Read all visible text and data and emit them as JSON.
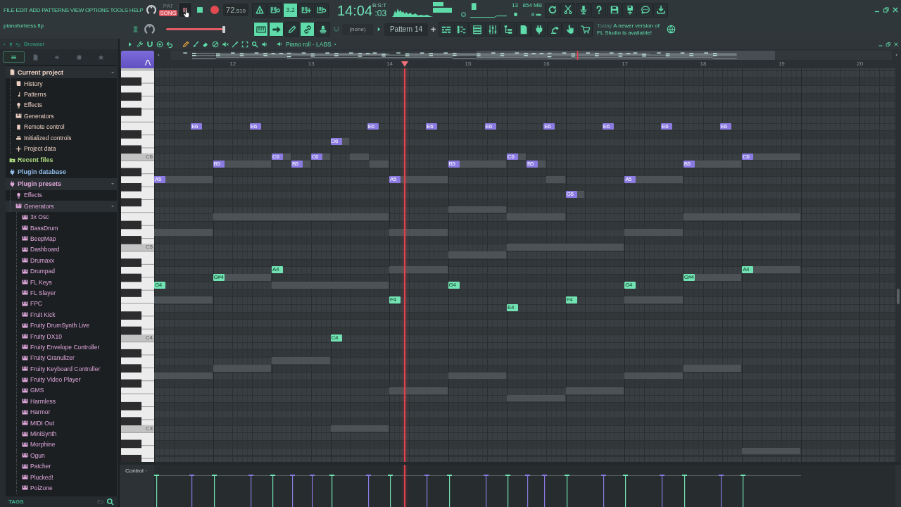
{
  "menu": [
    "FILE",
    "EDIT",
    "ADD",
    "PATTERNS",
    "VIEW",
    "OPTIONS",
    "TOOLS",
    "HELP"
  ],
  "project_file": "pianofortress.flp",
  "transport": {
    "pat_label": "PAT",
    "song_label": "SONG",
    "song_mode": true,
    "playing": true,
    "tempo": "72",
    "tempo_decimals": ".510"
  },
  "record_options": [
    {
      "on": false
    },
    {
      "on": false
    },
    {
      "label": "3.2",
      "on": true
    },
    {
      "on": false
    },
    {
      "on": false
    }
  ],
  "clock": {
    "time": "14:04",
    "seconds": ":03",
    "format": "B:S:T"
  },
  "monitor": {
    "voices": "13",
    "memory": "854 MB",
    "polyphony": "8"
  },
  "song_position": {
    "level": 0.98
  },
  "tool_buttons": [
    {
      "on": true
    },
    {
      "on": true
    },
    {
      "on": false
    },
    {
      "on": true
    },
    {
      "on": false
    }
  ],
  "pattern": {
    "channel": "(none)",
    "name": "Pattern 14"
  },
  "news": {
    "date": "Today",
    "message": "A newer version of FL Studio is available!"
  },
  "browser": {
    "title": "Browser",
    "tabs": [
      {
        "selected": true
      },
      {
        "selected": false
      },
      {
        "selected": false
      },
      {
        "selected": false
      },
      {
        "selected": false
      }
    ],
    "tree": [
      {
        "label": "Current project",
        "color": "#ecd0c2",
        "expanded": true,
        "children": [
          {
            "label": "History"
          },
          {
            "label": "Patterns"
          },
          {
            "label": "Effects"
          },
          {
            "label": "Generators"
          },
          {
            "label": "Remote control"
          },
          {
            "label": "Initialized controls"
          },
          {
            "label": "Project data"
          }
        ]
      },
      {
        "label": "Recent files",
        "color": "#a9d77c",
        "expanded": false
      },
      {
        "label": "Plugin database",
        "color": "#8fbbe8",
        "expanded": false
      },
      {
        "label": "Plugin presets",
        "color": "#dfa6da",
        "expanded": true,
        "children": [
          {
            "label": "Effects",
            "expanded": false
          },
          {
            "label": "Generators",
            "expanded": true,
            "children": [
              {
                "label": "3x Osc"
              },
              {
                "label": "BassDrum"
              },
              {
                "label": "BeepMap"
              },
              {
                "label": "Dashboard"
              },
              {
                "label": "Drumaxx"
              },
              {
                "label": "Drumpad"
              },
              {
                "label": "FL Keys"
              },
              {
                "label": "FL Slayer"
              },
              {
                "label": "FPC"
              },
              {
                "label": "Fruit Kick"
              },
              {
                "label": "Fruity DrumSynth Live"
              },
              {
                "label": "Fruity DX10"
              },
              {
                "label": "Fruity Envelope Controller"
              },
              {
                "label": "Fruity Granulizer"
              },
              {
                "label": "Fruity Keyboard Controller"
              },
              {
                "label": "Fruity Video Player"
              },
              {
                "label": "GMS"
              },
              {
                "label": "Harmless"
              },
              {
                "label": "Harmor"
              },
              {
                "label": "MIDI Out"
              },
              {
                "label": "MiniSynth"
              },
              {
                "label": "Morphine"
              },
              {
                "label": "Ogun"
              },
              {
                "label": "Patcher"
              },
              {
                "label": "Plucked!"
              },
              {
                "label": "PoiZone"
              }
            ]
          }
        ]
      }
    ],
    "footer": "TAGS"
  },
  "piano_roll": {
    "title": "Piano roll - LABS",
    "ruler": [
      "12",
      "13",
      "14",
      "15",
      "16",
      "17",
      "18",
      "19",
      "20"
    ],
    "keyboard_labels": [
      "C6",
      "C5",
      "C4",
      "C3"
    ],
    "notes": [
      {
        "label": "A5",
        "color": "#8a7ae2"
      },
      {
        "label": "G4",
        "color": "#72e3b3"
      },
      {
        "label": "E6",
        "color": "#8a7ae2"
      },
      {
        "label": "B5",
        "color": "#8a7ae2"
      },
      {
        "label": "G#4",
        "color": "#72e3b3"
      },
      {
        "label": "E6",
        "color": "#8a7ae2"
      },
      {
        "label": "C6",
        "color": "#8a7ae2"
      },
      {
        "label": "A4",
        "color": "#72e3b3"
      },
      {
        "label": "B5",
        "color": "#8a7ae2"
      },
      {
        "label": "C6",
        "color": "#8a7ae2"
      },
      {
        "label": "D6",
        "color": "#8a7ae2"
      },
      {
        "label": "C4",
        "color": "#72e3b3"
      },
      {
        "label": "E6",
        "color": "#8a7ae2"
      },
      {
        "label": "A5",
        "color": "#8a7ae2"
      },
      {
        "label": "F4",
        "color": "#72e3b3"
      },
      {
        "label": "E6",
        "color": "#8a7ae2"
      },
      {
        "label": "B5",
        "color": "#8a7ae2"
      },
      {
        "label": "G4",
        "color": "#72e3b3"
      },
      {
        "label": "E6",
        "color": "#8a7ae2"
      },
      {
        "label": "C6",
        "color": "#8a7ae2"
      },
      {
        "label": "E4",
        "color": "#72e3b3"
      },
      {
        "label": "B5",
        "color": "#8a7ae2"
      },
      {
        "label": "E6",
        "color": "#8a7ae2"
      },
      {
        "label": "G5",
        "color": "#8a7ae2"
      },
      {
        "label": "F4",
        "color": "#72e3b3"
      },
      {
        "label": "E6",
        "color": "#8a7ae2"
      },
      {
        "label": "A5",
        "color": "#8a7ae2"
      },
      {
        "label": "G4",
        "color": "#72e3b3"
      },
      {
        "label": "E6",
        "color": "#8a7ae2"
      },
      {
        "label": "B5",
        "color": "#8a7ae2"
      },
      {
        "label": "G#4",
        "color": "#72e3b3"
      },
      {
        "label": "E6",
        "color": "#8a7ae2"
      },
      {
        "label": "C6",
        "color": "#8a7ae2"
      },
      {
        "label": "A4",
        "color": "#72e3b3"
      }
    ],
    "control_label": "Control"
  }
}
